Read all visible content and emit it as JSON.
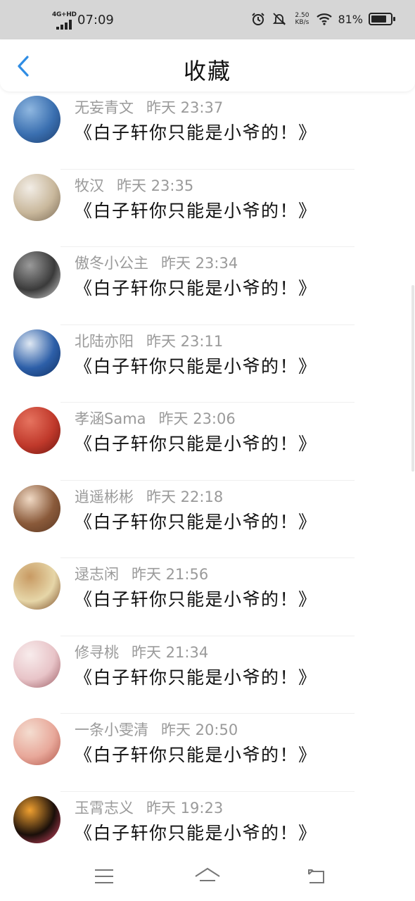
{
  "status_bar": {
    "network": "4G+HD",
    "time": "07:09",
    "net_speed_value": "2.50",
    "net_speed_unit": "KB/s",
    "battery_percent_text": "81%",
    "battery_level": 0.81,
    "icons": [
      "signal-icon",
      "alarm-icon",
      "mute-icon",
      "wifi-icon",
      "battery-icon"
    ]
  },
  "header": {
    "title": "收藏",
    "back_icon": "chevron-left-icon",
    "accent_color": "#2f8de4"
  },
  "favorites": [
    {
      "name": "无妄青文",
      "time": "昨天 23:37",
      "content": "《白子轩你只能是小爷的！》",
      "avatar_colors": [
        "#3a6fb0",
        "#8fb7e0",
        "#1d3e6e"
      ]
    },
    {
      "name": "牧汉",
      "time": "昨天 23:35",
      "content": "《白子轩你只能是小爷的！》",
      "avatar_colors": [
        "#c9b89c",
        "#f2ede6",
        "#7a6a55"
      ]
    },
    {
      "name": "傲冬小公主",
      "time": "昨天 23:34",
      "content": "《白子轩你只能是小爷的！》",
      "avatar_colors": [
        "#3a3a3a",
        "#9a9a9a",
        "#d8d8d8"
      ]
    },
    {
      "name": "北陆亦阳",
      "time": "昨天 23:11",
      "content": "《白子轩你只能是小爷的！》",
      "avatar_colors": [
        "#2d5fa8",
        "#dfe8f3",
        "#0f2f63"
      ]
    },
    {
      "name": "孝涵Sama",
      "time": "昨天 23:06",
      "content": "《白子轩你只能是小爷的！》",
      "avatar_colors": [
        "#c0392b",
        "#e6735f",
        "#6e1610"
      ]
    },
    {
      "name": "逍遥彬彬",
      "time": "昨天 22:18",
      "content": "《白子轩你只能是小爷的！》",
      "avatar_colors": [
        "#8a5a3a",
        "#f0d9c4",
        "#5a3722"
      ]
    },
    {
      "name": "逯志闲",
      "time": "昨天 21:56",
      "content": "《白子轩你只能是小爷的！》",
      "avatar_colors": [
        "#e6d6a8",
        "#c89a63",
        "#7a4a25"
      ]
    },
    {
      "name": "修寻桃",
      "time": "昨天 21:34",
      "content": "《白子轩你只能是小爷的！》",
      "avatar_colors": [
        "#e8c4c8",
        "#f8ecec",
        "#9a5a62"
      ]
    },
    {
      "name": "一条小雯清",
      "time": "昨天 20:50",
      "content": "《白子轩你只能是小爷的！》",
      "avatar_colors": [
        "#e8a89a",
        "#f4ddd0",
        "#b0564a"
      ]
    },
    {
      "name": "玉霄志义",
      "time": "昨天 19:23",
      "content": "《白子轩你只能是小爷的！》",
      "avatar_colors": [
        "#1a0f0a",
        "#f0a030",
        "#e04a6a"
      ]
    }
  ],
  "nav_bar": {
    "buttons": [
      "menu-icon",
      "home-icon",
      "back-icon"
    ]
  }
}
